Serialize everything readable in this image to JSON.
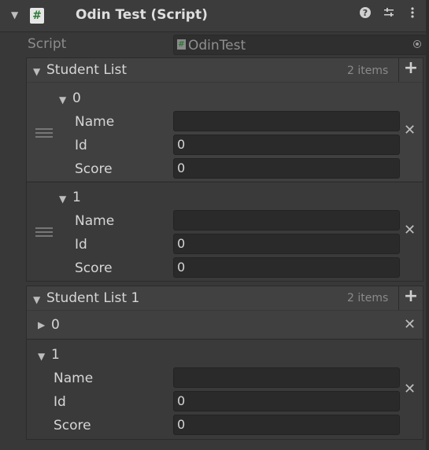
{
  "header": {
    "title": "Odin Test (Script)",
    "script_icon": "#",
    "help_icon": "help-icon",
    "settings_icon": "sliders-icon",
    "menu_icon": "kebab-menu-icon"
  },
  "script_row": {
    "label": "Script",
    "value": "OdinTest"
  },
  "list1": {
    "title": "Student List",
    "count": "2 items",
    "items": [
      {
        "index": "0",
        "fields": [
          {
            "label": "Name",
            "value": ""
          },
          {
            "label": "Id",
            "value": "0"
          },
          {
            "label": "Score",
            "value": "0"
          }
        ]
      },
      {
        "index": "1",
        "fields": [
          {
            "label": "Name",
            "value": ""
          },
          {
            "label": "Id",
            "value": "0"
          },
          {
            "label": "Score",
            "value": "0"
          }
        ]
      }
    ]
  },
  "list2": {
    "title": "Student List 1",
    "count": "2 items",
    "items": [
      {
        "index": "0",
        "collapsed": true
      },
      {
        "index": "1",
        "fields": [
          {
            "label": "Name",
            "value": ""
          },
          {
            "label": "Id",
            "value": "0"
          },
          {
            "label": "Score",
            "value": "0"
          }
        ]
      }
    ]
  },
  "glyphs": {
    "expanded": "▼",
    "collapsed": "▶",
    "add": "+",
    "remove": "✕"
  }
}
